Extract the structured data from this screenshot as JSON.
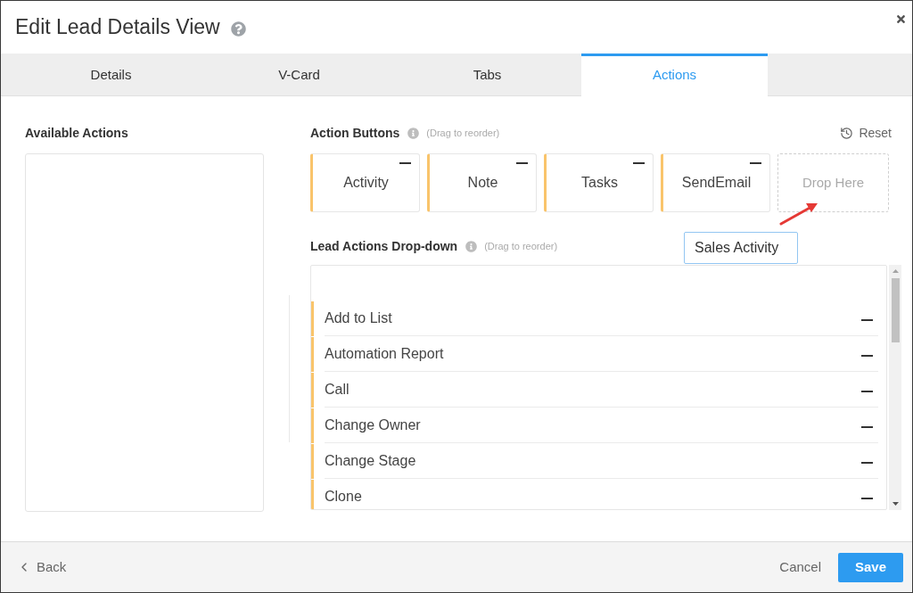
{
  "dialog": {
    "title": "Edit Lead Details View"
  },
  "tabs": [
    {
      "label": "Details",
      "selected": false
    },
    {
      "label": "V-Card",
      "selected": false
    },
    {
      "label": "Tabs",
      "selected": false
    },
    {
      "label": "Actions",
      "selected": true
    }
  ],
  "available_actions": {
    "heading": "Available Actions"
  },
  "action_buttons": {
    "heading": "Action Buttons",
    "hint": "(Drag to reorder)",
    "reset": "Reset",
    "items": [
      {
        "label": "Activity"
      },
      {
        "label": "Note"
      },
      {
        "label": "Tasks"
      },
      {
        "label": "SendEmail"
      }
    ],
    "drop_zone": "Drop Here"
  },
  "dragged_item": {
    "label": "Sales Activity"
  },
  "lead_actions_dropdown": {
    "heading": "Lead Actions Drop-down",
    "hint": "(Drag to reorder)",
    "items": [
      {
        "label": "Add to List"
      },
      {
        "label": "Automation Report"
      },
      {
        "label": "Call"
      },
      {
        "label": "Change Owner"
      },
      {
        "label": "Change Stage"
      },
      {
        "label": "Clone"
      }
    ]
  },
  "footer": {
    "back": "Back",
    "cancel": "Cancel",
    "save": "Save"
  }
}
